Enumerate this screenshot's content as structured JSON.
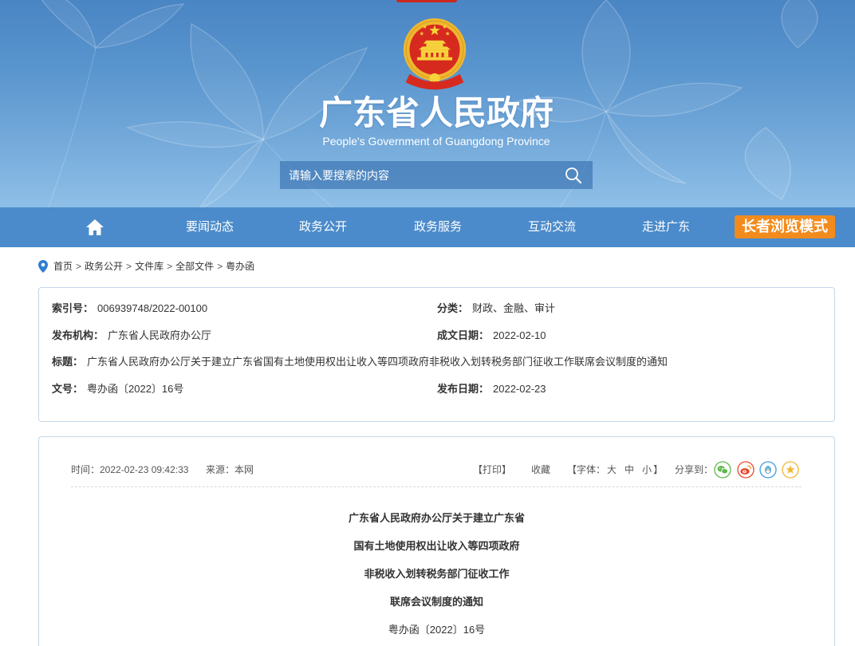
{
  "colors": {
    "header_top": "#4a85c4",
    "header_bottom": "#8ebfe7",
    "nav_bg": "#4b8bcb",
    "elder_button": "#f28b1d",
    "emblem_red": "#d62a1f",
    "emblem_gold": "#f2c03a",
    "text": "#333333",
    "box_border": "#c3d7e8",
    "breadcrumb_pin": "#2f7fd3"
  },
  "header": {
    "emblem_icon": "national-emblem-icon",
    "title": "广东省人民政府",
    "subtitle": "People's Government of Guangdong Province",
    "search": {
      "placeholder": "请输入要搜索的内容",
      "icon": "search-icon"
    }
  },
  "nav": {
    "home_icon": "home-icon",
    "items": [
      "要闻动态",
      "政务公开",
      "政务服务",
      "互动交流",
      "走进广东"
    ],
    "elder_mode": "长者浏览模式"
  },
  "breadcrumb": {
    "icon": "location-pin-icon",
    "separator": ">",
    "items": [
      "首页",
      "政务公开",
      "文件库",
      "全部文件",
      "粤办函"
    ]
  },
  "info": {
    "index": {
      "label": "索引号：",
      "value": "006939748/2022-00100"
    },
    "category": {
      "label": "分类：",
      "value": "财政、金融、审计"
    },
    "publisher": {
      "label": "发布机构：",
      "value": "广东省人民政府办公厅"
    },
    "written_date": {
      "label": "成文日期：",
      "value": "2022-02-10"
    },
    "title": {
      "label": "标题：",
      "value": "广东省人民政府办公厅关于建立广东省国有土地使用权出让收入等四项政府非税收入划转税务部门征收工作联席会议制度的通知"
    },
    "doc_number": {
      "label": "文号：",
      "value": "粤办函〔2022〕16号"
    },
    "publish_date": {
      "label": "发布日期：",
      "value": "2022-02-23"
    }
  },
  "article": {
    "time": "时间：2022-02-23 09:42:33",
    "source": "来源：本网",
    "tools": {
      "print": "【打印】",
      "favorite": "收藏",
      "font_open": "【字体：",
      "font_large": "大",
      "font_medium": "中",
      "font_small": "小",
      "font_close": "】",
      "share_label": "分享到：",
      "share_icons": [
        "wechat-icon",
        "weibo-icon",
        "qq-icon",
        "qzone-icon"
      ]
    },
    "title_lines": [
      "广东省人民政府办公厅关于建立广东省",
      "国有土地使用权出让收入等四项政府",
      "非税收入划转税务部门征收工作",
      "联席会议制度的通知"
    ],
    "doc_number": "粤办函〔2022〕16号"
  }
}
